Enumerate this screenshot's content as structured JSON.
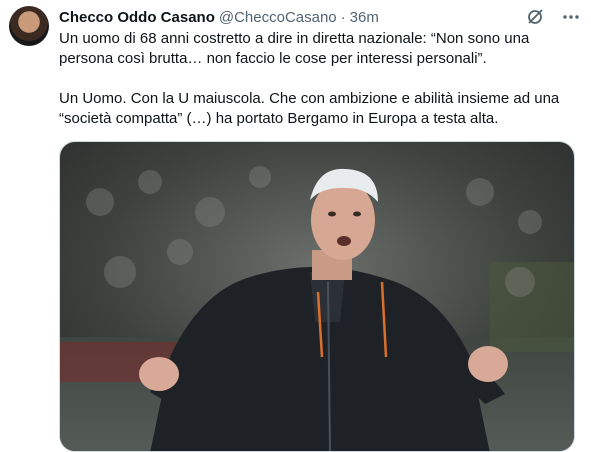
{
  "tweet": {
    "display_name": "Checco Oddo Casano",
    "handle": "@CheccoCasano",
    "separator": "·",
    "time": "36m",
    "paragraphs": [
      "Un uomo di 68 anni costretto a dire in diretta nazionale: “Non sono una\npersona così brutta… non faccio le cose per interessi personali”.",
      "Un Uomo. Con la U maiuscola. Che con ambizione e abilità insieme ad una\n“società compatta” (…) ha portato Bergamo in Europa a testa alta."
    ]
  },
  "icons": {
    "grok": "grok-icon",
    "more": "more-icon"
  },
  "colors": {
    "text": "#0f1419",
    "secondary": "#536471",
    "border": "#cfd9de"
  }
}
